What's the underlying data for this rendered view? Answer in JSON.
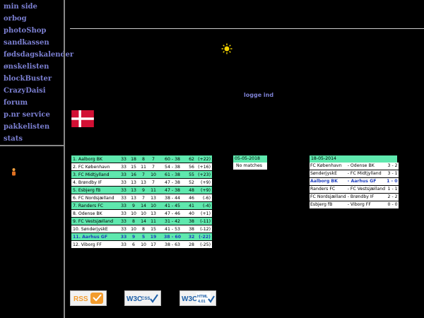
{
  "nav": {
    "items": [
      {
        "label": "min side"
      },
      {
        "label": "orbog"
      },
      {
        "label": "photoShop"
      },
      {
        "label": "sandkassen"
      },
      {
        "label": "fødsdagskalender"
      },
      {
        "label": "ønskelisten"
      },
      {
        "label": "blockBuster"
      },
      {
        "label": "CrazyDaisi"
      },
      {
        "label": "forum"
      },
      {
        "label": "p.nr service"
      },
      {
        "label": "pakkelisten"
      },
      {
        "label": "stats"
      }
    ]
  },
  "login": {
    "label": "logge ind"
  },
  "flag": {
    "icon": "danish-flag-icon",
    "colors": {
      "red": "#d21034",
      "white": "#ffffff"
    }
  },
  "colors": {
    "accent_row": "#5fe8ae",
    "nav_text": "#7b7fd1",
    "own_team": "#1f3fbf"
  },
  "standings": {
    "rows": [
      {
        "name": "1. Aalborg BK",
        "p": "33",
        "w": "18",
        "d": "8",
        "l": "7",
        "goals": "60 - 38",
        "pts": "62",
        "diff": "(+22)",
        "hl": true
      },
      {
        "name": "2. FC København",
        "p": "33",
        "w": "15",
        "d": "11",
        "l": "7",
        "goals": "54 - 38",
        "pts": "56",
        "diff": "(+16)",
        "hl": false
      },
      {
        "name": "3. FC Midtjylland",
        "p": "33",
        "w": "16",
        "d": "7",
        "l": "10",
        "goals": "61 - 38",
        "pts": "55",
        "diff": "(+23)",
        "hl": true
      },
      {
        "name": "4. Brøndby IF",
        "p": "33",
        "w": "13",
        "d": "13",
        "l": "7",
        "goals": "47 - 38",
        "pts": "52",
        "diff": "(+9)",
        "hl": false
      },
      {
        "name": "5. Esbjerg fB",
        "p": "33",
        "w": "13",
        "d": "9",
        "l": "11",
        "goals": "47 - 38",
        "pts": "48",
        "diff": "(+9)",
        "hl": true
      },
      {
        "name": "6. FC Nordsjælland",
        "p": "33",
        "w": "13",
        "d": "7",
        "l": "13",
        "goals": "38 - 44",
        "pts": "46",
        "diff": "(-6)",
        "hl": false
      },
      {
        "name": "7. Randers FC",
        "p": "33",
        "w": "9",
        "d": "14",
        "l": "10",
        "goals": "41 - 45",
        "pts": "41",
        "diff": "(-4)",
        "hl": true
      },
      {
        "name": "8. Odense BK",
        "p": "33",
        "w": "10",
        "d": "10",
        "l": "13",
        "goals": "47 - 46",
        "pts": "40",
        "diff": "(+1)",
        "hl": false
      },
      {
        "name": "9. FC Vestsjælland",
        "p": "33",
        "w": "8",
        "d": "14",
        "l": "11",
        "goals": "31 - 42",
        "pts": "38",
        "diff": "(-11)",
        "hl": true
      },
      {
        "name": "10. SønderjyskE",
        "p": "33",
        "w": "10",
        "d": "8",
        "l": "15",
        "goals": "41 - 53",
        "pts": "38",
        "diff": "(-12)",
        "hl": false
      },
      {
        "name": "11. Aarhus GF",
        "p": "33",
        "w": "9",
        "d": "5",
        "l": "19",
        "goals": "38 - 60",
        "pts": "32",
        "diff": "(-22)",
        "hl": true,
        "own": true
      },
      {
        "name": "12. Viborg FF",
        "p": "33",
        "w": "6",
        "d": "10",
        "l": "17",
        "goals": "38 - 63",
        "pts": "28",
        "diff": "(-25)",
        "hl": false
      }
    ]
  },
  "upcoming": {
    "date": "05-05-2018",
    "text": "No matches"
  },
  "results": {
    "date": "18-05-2014",
    "rows": [
      {
        "home": "FC København",
        "away": "- Odense BK",
        "score": "3 - 2"
      },
      {
        "home": "SønderjyskE",
        "away": "- FC Midtjylland",
        "score": "3 - 1"
      },
      {
        "home": "Aalborg BK",
        "away": "- Aarhus GF",
        "score": "1 - 0",
        "own": true
      },
      {
        "home": "Randers FC",
        "away": "- FC Vestsjælland",
        "score": "1 - 1"
      },
      {
        "home": "FC Nordsjælland",
        "away": "- Brøndby IF",
        "score": "2 - 2"
      },
      {
        "home": "Esbjerg fB",
        "away": "- Viborg FF",
        "score": "0 - 0"
      }
    ]
  },
  "badges": {
    "rss": "RSS",
    "css": "CSS",
    "html_label": "HTML",
    "html_version": "4.01",
    "w3c": "W3C"
  }
}
